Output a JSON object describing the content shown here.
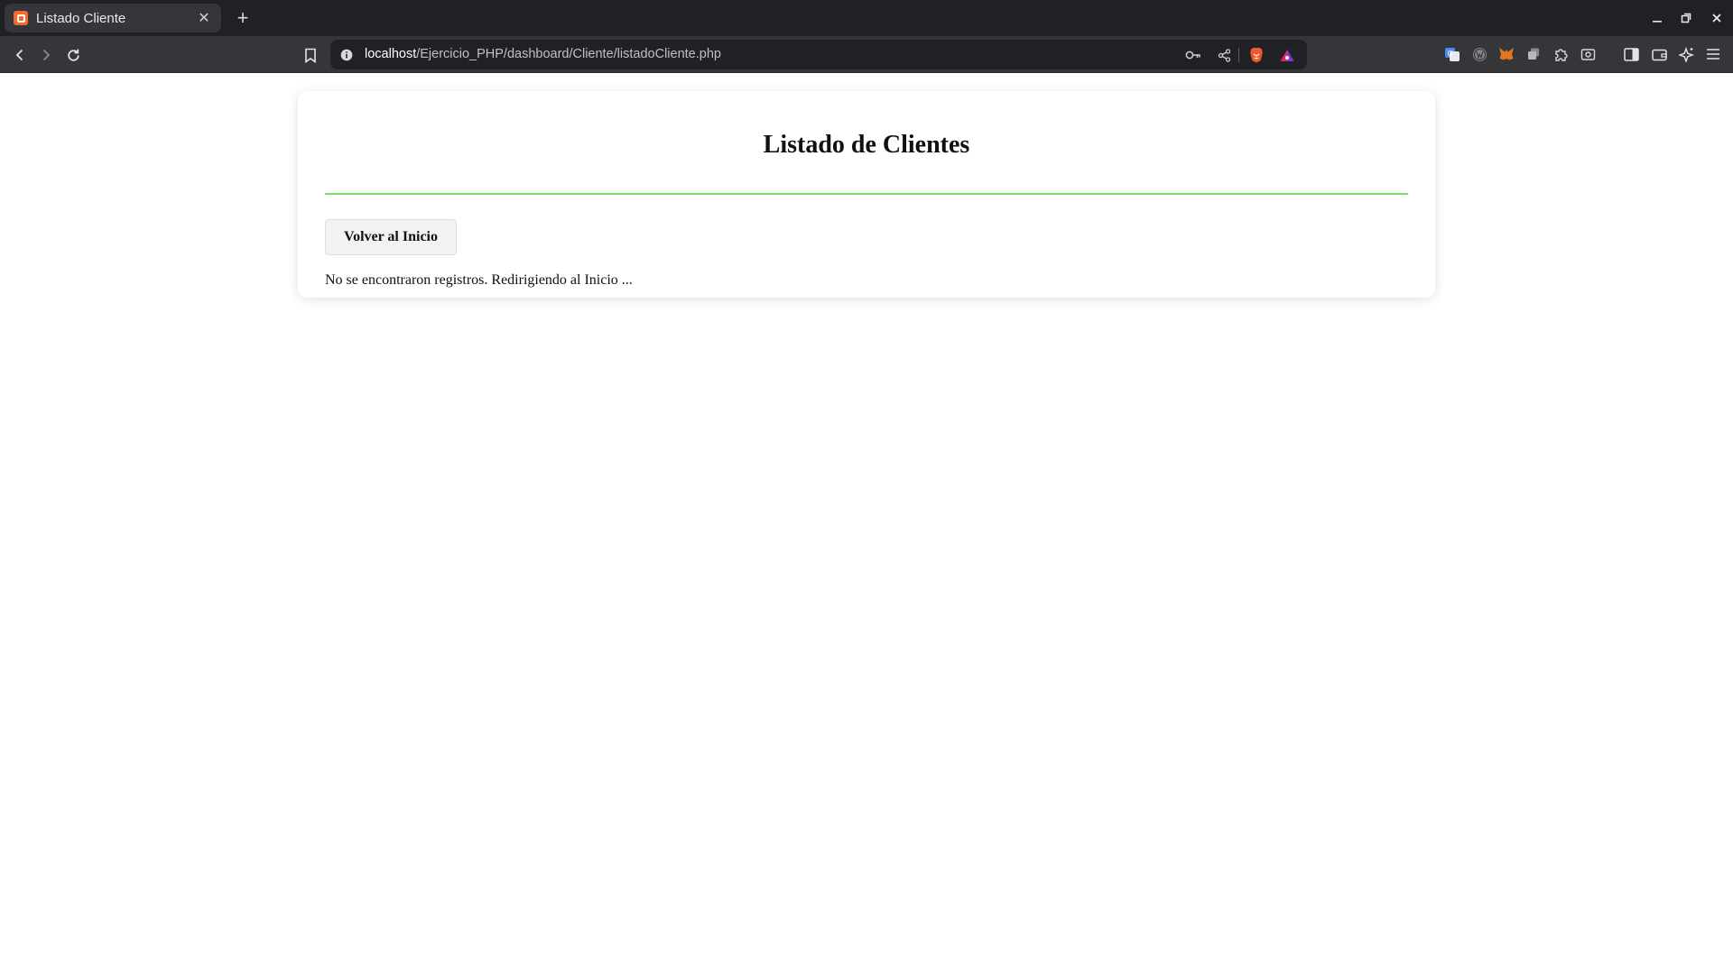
{
  "browser": {
    "tab": {
      "title": "Listado Cliente",
      "close_glyph": "✕"
    },
    "new_tab_glyph": "+",
    "url": {
      "host": "localhost",
      "path": "/Ejercicio_PHP/dashboard/Cliente/listadoCliente.php"
    },
    "icons": {
      "favicon": "xampp-icon",
      "back": "back-arrow-icon",
      "forward": "forward-arrow-icon",
      "reload": "reload-icon",
      "bookmark": "bookmark-icon",
      "site_info": "info-icon",
      "password_key": "key-icon",
      "share": "share-icon",
      "brave_shields": "brave-lion-icon",
      "brave_rewards": "rewards-triangle-icon",
      "translate": "translate-icon",
      "extensions": [
        "wordpress-icon",
        "metamask-icon",
        "copy-icon",
        "puzzle-icon",
        "screenshot-icon"
      ],
      "sidebar": "sidebar-icon",
      "wallet": "wallet-icon",
      "leo": "leo-sparkle-icon",
      "menu": "hamburger-menu-icon"
    },
    "colors": {
      "tabbar_bg": "#202125",
      "toolbar_bg": "#35363a",
      "omnibox_bg": "#202125"
    }
  },
  "page": {
    "title": "Listado de Clientes",
    "back_button_label": "Volver al Inicio",
    "message": "No se encontraron registros. Redirigiendo al Inicio ...",
    "colors": {
      "accent_rule": "#7ddd6a",
      "card_bg": "#ffffff",
      "button_bg": "#f2f2f2"
    }
  }
}
